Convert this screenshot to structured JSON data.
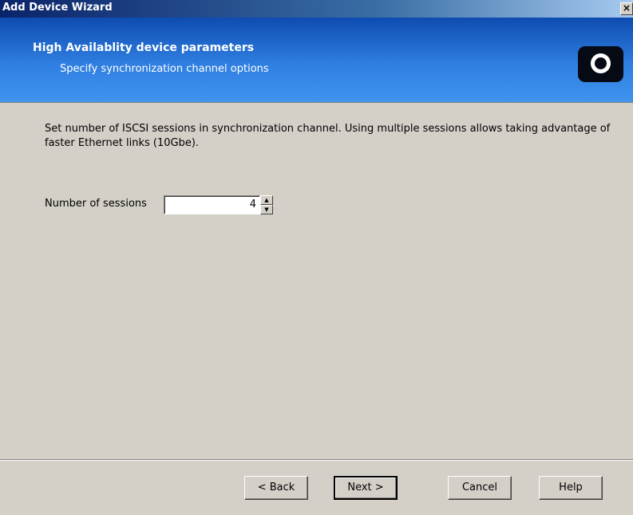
{
  "window": {
    "title": "Add Device Wizard",
    "close_glyph": "×"
  },
  "header": {
    "title": "High Availablity device parameters",
    "subtitle": "Specify synchronization channel options",
    "logo_icon": "starwind-logo-icon"
  },
  "main": {
    "description": "Set number of ISCSI sessions in synchronization channel. Using multiple sessions allows taking advantage of faster Ethernet links (10Gbe).",
    "sessions": {
      "label": "Number of sessions",
      "value": "4",
      "up_glyph": "▲",
      "down_glyph": "▼"
    }
  },
  "footer": {
    "back_label": "< Back",
    "next_label": "Next >",
    "cancel_label": "Cancel",
    "help_label": "Help"
  }
}
